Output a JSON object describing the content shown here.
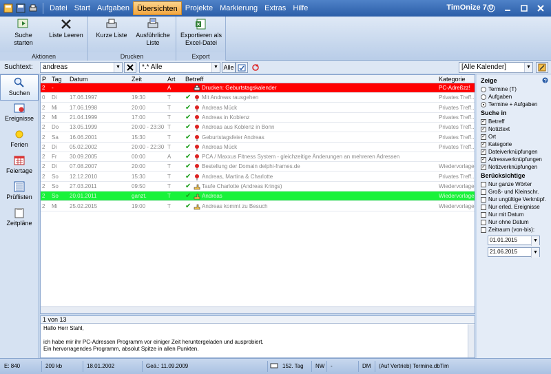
{
  "menu": [
    "Datei",
    "Start",
    "Aufgaben",
    "Übersichten",
    "Projekte",
    "Markierung",
    "Extras",
    "Hilfe"
  ],
  "menu_active": "Übersichten",
  "app_title": "TimOnize 7.0",
  "ribbon": {
    "aktionen": {
      "label": "Aktionen",
      "suche_starten": "Suche starten",
      "liste_leeren": "Liste Leeren"
    },
    "drucken": {
      "label": "Drucken",
      "kurze_liste": "Kurze Liste",
      "ausfuehrliche_liste": "Ausführliche Liste"
    },
    "export": {
      "label": "Export",
      "exportieren": "Exportieren als Excel-Datei"
    }
  },
  "search": {
    "label": "Suchtext:",
    "value": "andreas",
    "filter": "*.* Alle",
    "alle": "Alle",
    "calendar": "[Alle Kalender]"
  },
  "nav": [
    "Suchen",
    "Ereignisse",
    "Ferien",
    "Feiertage",
    "Prüflisten",
    "Zeitpläne"
  ],
  "grid": {
    "headers": {
      "p": "P",
      "tag": "Tag",
      "datum": "Datum",
      "zeit": "Zeit",
      "art": "Art",
      "betreff": "Betreff",
      "kategorie": "Kategorie"
    },
    "rows": [
      {
        "p": "2",
        "tag": "-",
        "datum": "",
        "zeit": "",
        "art": "A",
        "betreff": "Drucken: Geburtstagskalender",
        "kategorie": "PC-Adreßzz!",
        "style": "red",
        "check": false,
        "icon": "printer"
      },
      {
        "p": "0",
        "tag": "Di",
        "datum": "17.06.1997",
        "zeit": "19:30",
        "art": "T",
        "betreff": "Mit Andreas rausgehen",
        "kategorie": "Privates Treff...",
        "style": "",
        "check": true,
        "icon": "pin"
      },
      {
        "p": "2",
        "tag": "Mi",
        "datum": "17.06.1998",
        "zeit": "20:00",
        "art": "T",
        "betreff": "Andreas Mück",
        "kategorie": "Privates Treff...",
        "style": "",
        "check": true,
        "icon": "pin"
      },
      {
        "p": "2",
        "tag": "Mi",
        "datum": "21.04.1999",
        "zeit": "17:00",
        "art": "T",
        "betreff": "Andreas in Koblenz",
        "kategorie": "Privates Treff...",
        "style": "",
        "check": true,
        "icon": "pin"
      },
      {
        "p": "2",
        "tag": "Do",
        "datum": "13.05.1999",
        "zeit": "20:00 - 23:30",
        "art": "T",
        "betreff": "Andreas aus Koblenz in Bonn",
        "kategorie": "Privates Treff...",
        "style": "",
        "check": true,
        "icon": "pin"
      },
      {
        "p": "2",
        "tag": "Sa",
        "datum": "16.06.2001",
        "zeit": "15:30",
        "art": "T",
        "betreff": "Geburtstagsfeier Andreas",
        "kategorie": "Privates Treff...",
        "style": "",
        "check": true,
        "icon": "pin"
      },
      {
        "p": "2",
        "tag": "Di",
        "datum": "05.02.2002",
        "zeit": "20:00 - 22:30",
        "art": "T",
        "betreff": "Andreas Mück",
        "kategorie": "Privates Treff...",
        "style": "",
        "check": true,
        "icon": "pin"
      },
      {
        "p": "2",
        "tag": "Fr",
        "datum": "30.09.2005",
        "zeit": "00:00",
        "art": "A",
        "betreff": "PCA / Maxxus Fitness System - gleichzeitige Änderungen an mehreren Adressen",
        "kategorie": "",
        "style": "",
        "check": true,
        "icon": "pin"
      },
      {
        "p": "2",
        "tag": "Di",
        "datum": "07.08.2007",
        "zeit": "20:00",
        "art": "T",
        "betreff": "Bestellung der Domain delphi-frames.de",
        "kategorie": "Wiedervorlage",
        "style": "",
        "check": true,
        "icon": "pin"
      },
      {
        "p": "2",
        "tag": "So",
        "datum": "12.12.2010",
        "zeit": "15:30",
        "art": "T",
        "betreff": "Andreas, Martina & Charlotte",
        "kategorie": "Privates Treff...",
        "style": "",
        "check": true,
        "icon": "pin"
      },
      {
        "p": "2",
        "tag": "So",
        "datum": "27.03.2011",
        "zeit": "09:50",
        "art": "T",
        "betreff": "Taufe Charlotte (Andreas Krings)",
        "kategorie": "Wiedervorlage",
        "style": "",
        "check": true,
        "icon": "hand"
      },
      {
        "p": "2",
        "tag": "So",
        "datum": "20.01.2011",
        "zeit": "ganzt.",
        "art": "T",
        "betreff": "Andreas",
        "kategorie": "Wiedervorlage",
        "style": "green",
        "check": true,
        "icon": "hand"
      },
      {
        "p": "2",
        "tag": "Mi",
        "datum": "25.02.2015",
        "zeit": "19:00",
        "art": "T",
        "betreff": "Andreas kommt zu Besuch",
        "kategorie": "Wiedervorlage",
        "style": "",
        "check": true,
        "icon": "hand"
      }
    ]
  },
  "right": {
    "zeige": "Zeige",
    "zeige_opts": [
      "Termine (T)",
      "Aufgaben",
      "Termine + Aufgaben"
    ],
    "zeige_selected": 2,
    "suche_in": "Suche in",
    "suche_opts": [
      "Betreff",
      "Notiztext",
      "Ort",
      "Kategorie",
      "Dateiverknüpfungen",
      "Adressverknüpfungen",
      "Notizverknüpfungen"
    ],
    "beruecksichtige": "Berücksichtige",
    "ber_opts": [
      "Nur ganze Wörter",
      "Groß- und Kleinschr.",
      "Nur ungültige Verknüpf.",
      "Nur erled. Ereignisse",
      "Nur mit Datum",
      "Nur ohne Datum",
      "Zeitraum (von-bis):"
    ],
    "date_from": "01.01.2015",
    "date_to": "21.06.2015"
  },
  "detail": {
    "count": "1 von 13",
    "lines": [
      "Hallo Herr Stahl,",
      "",
      "ich habe mir ihr PC-Adressen Programm vor einiger Zeit heruntergeladen und ausprobiert.",
      "Ein hervorragendes Programm, absolut Spitze in allen Punkten."
    ]
  },
  "status": {
    "e": "E: 840",
    "kb": "209 kb",
    "date1": "18.01.2002",
    "gea": "Geä.: 11.09.2009",
    "tag": "152. Tag",
    "nw": "NW",
    "dash": "-",
    "dm": "DM",
    "file": "(Auf Vertrieb) Termine.dbTim"
  },
  "colors": {
    "accent": "#2b5ea8",
    "red_row": "#ff0000",
    "green_row": "#19f23a"
  }
}
